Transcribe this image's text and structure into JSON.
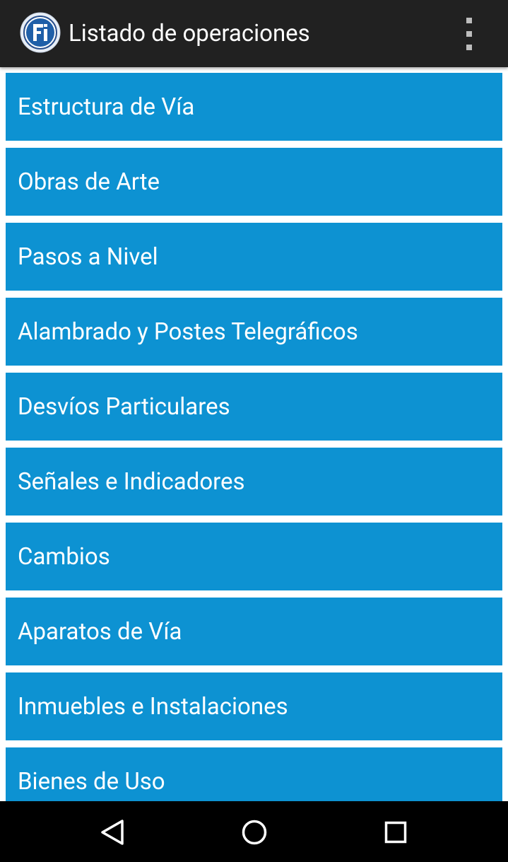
{
  "app_bar": {
    "title": "Listado de operaciones",
    "logo_text": "Fi",
    "overflow_icon": "more-vert-icon"
  },
  "operations": [
    {
      "label": "Estructura de Vía"
    },
    {
      "label": "Obras de Arte"
    },
    {
      "label": "Pasos a Nivel"
    },
    {
      "label": "Alambrado y Postes Telegráficos"
    },
    {
      "label": "Desvíos Particulares"
    },
    {
      "label": "Señales e Indicadores"
    },
    {
      "label": "Cambios"
    },
    {
      "label": "Aparatos de Vía"
    },
    {
      "label": "Inmuebles e Instalaciones"
    },
    {
      "label": "Bienes de Uso"
    }
  ],
  "navigation_bar": {
    "back_icon": "back-triangle-icon",
    "home_icon": "home-circle-icon",
    "recents_icon": "recents-square-icon"
  },
  "colors": {
    "toolbar_bg": "#212121",
    "item_bg": "#0d92d2",
    "item_text": "#ffffff",
    "navbar_bg": "#000000"
  }
}
